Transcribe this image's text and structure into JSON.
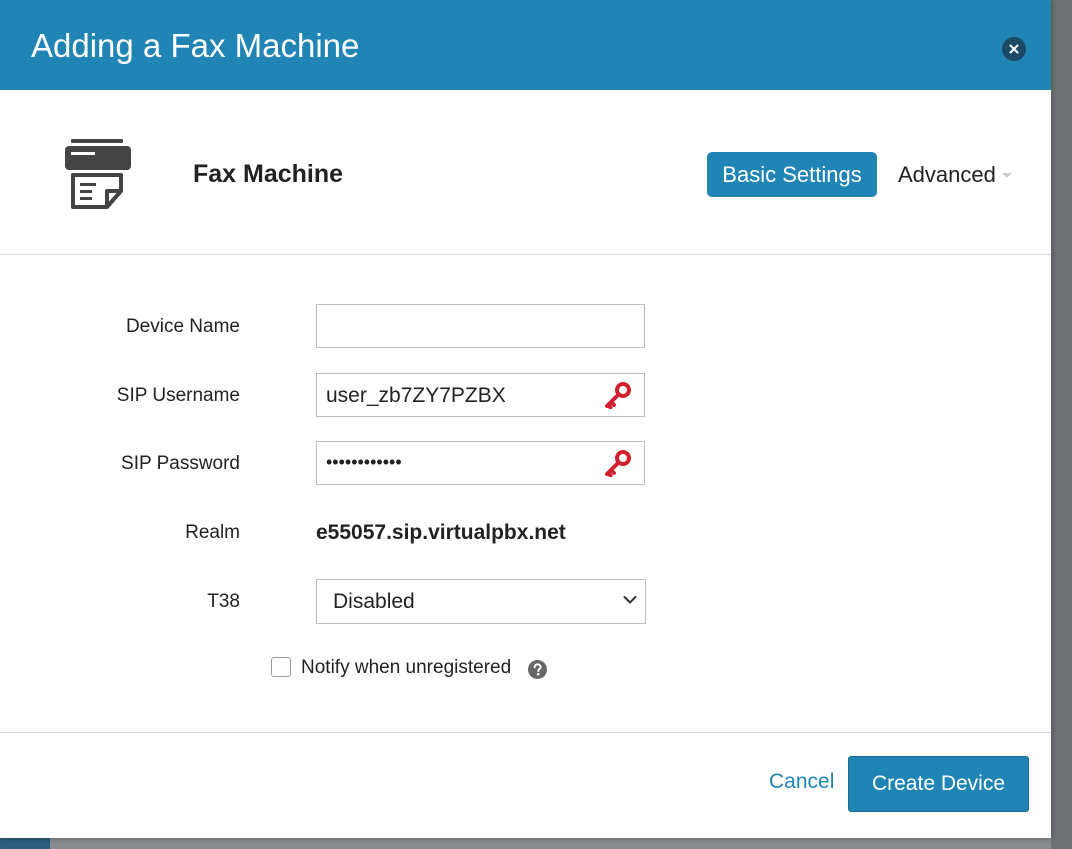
{
  "modal": {
    "title": "Adding a Fax Machine",
    "close_icon": "close-icon"
  },
  "device": {
    "icon": "fax-machine-icon",
    "type_label": "Fax Machine"
  },
  "tabs": {
    "basic_label": "Basic Settings",
    "advanced_label": "Advanced"
  },
  "form": {
    "device_name": {
      "label": "Device Name",
      "value": "",
      "placeholder": ""
    },
    "sip_username": {
      "label": "SIP Username",
      "value": "user_zb7ZY7PZBX",
      "icon": "key-icon"
    },
    "sip_password": {
      "label": "SIP Password",
      "value": "••••••••••••",
      "icon": "key-icon"
    },
    "realm": {
      "label": "Realm",
      "value": "e55057.sip.virtualpbx.net"
    },
    "t38": {
      "label": "T38",
      "selected": "Disabled"
    },
    "notify": {
      "label": "Notify when unregistered",
      "checked": false,
      "icon": "help-icon"
    }
  },
  "footer": {
    "cancel_label": "Cancel",
    "create_label": "Create Device"
  },
  "colors": {
    "accent": "#2085b4",
    "key_red": "#d0202e"
  }
}
